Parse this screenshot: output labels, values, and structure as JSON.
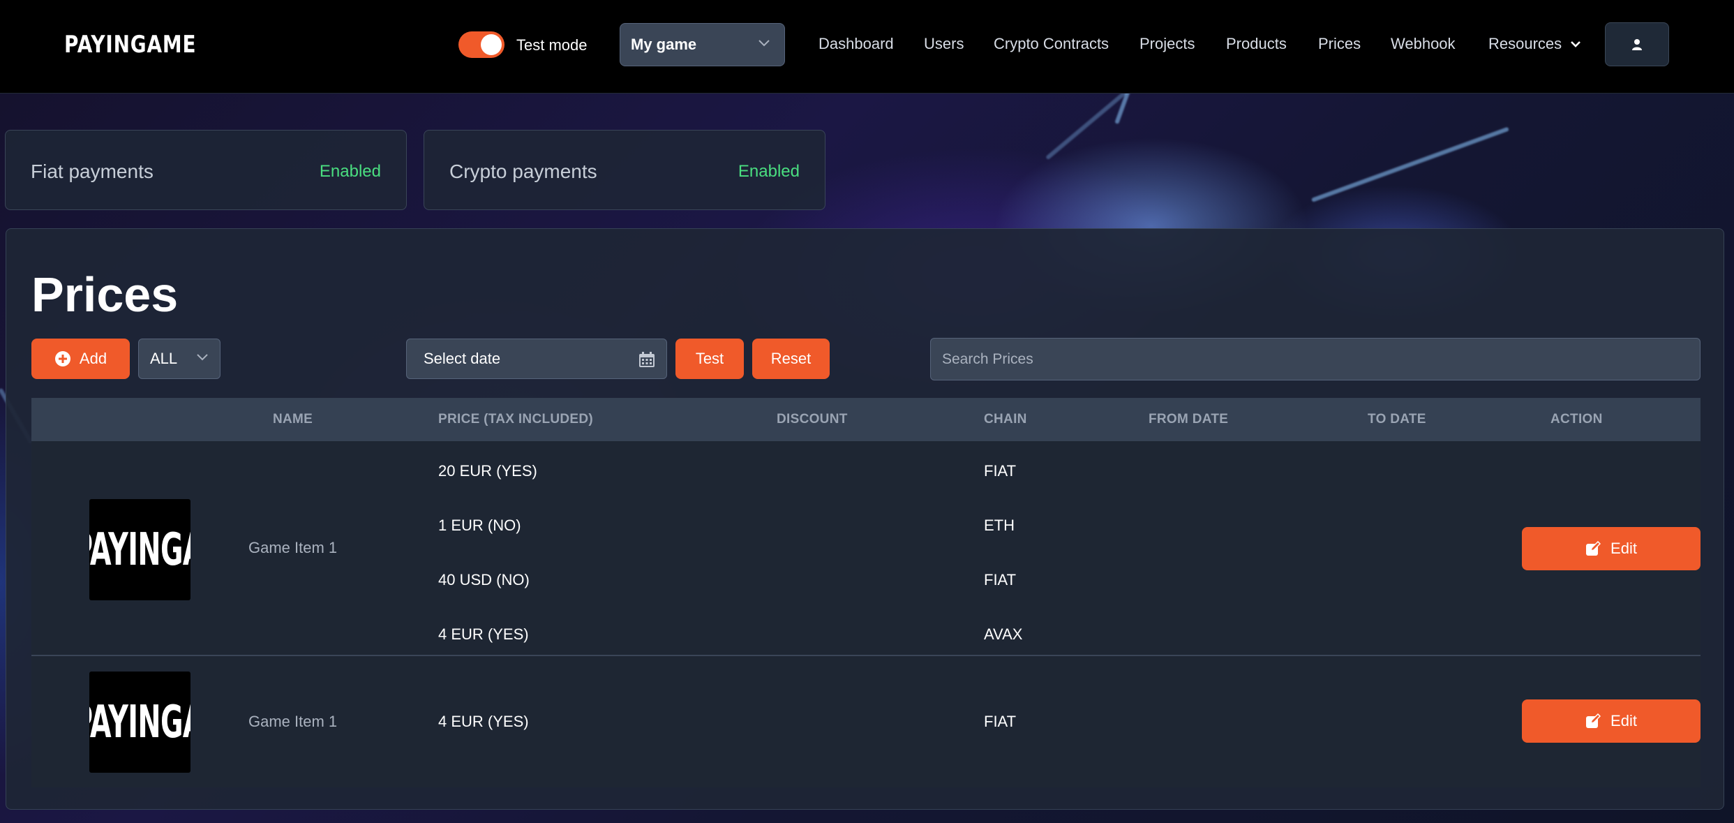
{
  "brand": {
    "logo": "PAYINGAME",
    "accent": "#f05a2a",
    "success": "#4ade80"
  },
  "topbar": {
    "test_mode_label": "Test mode",
    "test_mode_on": true,
    "game_select_value": "My game",
    "nav": [
      "Dashboard",
      "Users",
      "Crypto Contracts",
      "Projects",
      "Products",
      "Prices",
      "Webhook",
      "Resources"
    ],
    "user_icon": "user-icon"
  },
  "status": {
    "fiat": {
      "label": "Fiat payments",
      "value": "Enabled"
    },
    "crypto": {
      "label": "Crypto payments",
      "value": "Enabled"
    }
  },
  "prices": {
    "title": "Prices",
    "add_label": "Add",
    "filter_value": "ALL",
    "date_label": "Select date",
    "test_label": "Test",
    "reset_label": "Reset",
    "search_placeholder": "Search Prices",
    "columns": [
      "NAME",
      "PRICE (TAX INCLUDED)",
      "DISCOUNT",
      "CHAIN",
      "FROM DATE",
      "TO DATE",
      "ACTION"
    ],
    "rows": [
      {
        "thumb_text": "PAYINGAME",
        "name": "Game Item 1",
        "prices": [
          {
            "price": "20 EUR (YES)",
            "chain": "FIAT"
          },
          {
            "price": "1 EUR (NO)",
            "chain": "ETH"
          },
          {
            "price": "40 USD (NO)",
            "chain": "FIAT"
          },
          {
            "price": "4 EUR (YES)",
            "chain": "AVAX"
          }
        ],
        "action": "Edit"
      },
      {
        "thumb_text": "PAYINGAME",
        "name": "Game Item 1",
        "prices": [
          {
            "price": "4 EUR (YES)",
            "chain": "FIAT"
          }
        ],
        "action": "Edit"
      }
    ]
  }
}
